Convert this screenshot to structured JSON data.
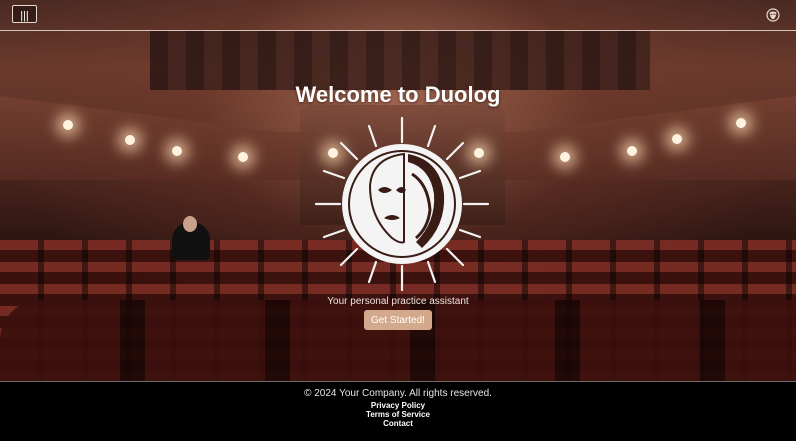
{
  "header": {
    "menu_icon": "hamburger-icon",
    "menu_glyph": "|||",
    "profile_icon": "theater-mask-icon"
  },
  "hero": {
    "title": "Welcome to Duolog",
    "logo_icon": "theater-mask-sun-logo",
    "tagline": "Your personal practice assistant",
    "cta_label": "Get Started!"
  },
  "footer": {
    "copyright": "© 2024 Your Company. All rights reserved.",
    "links": [
      "Privacy Policy",
      "Terms of Service",
      "Contact"
    ]
  },
  "colors": {
    "accent": "#d2a98c",
    "text": "#ffffff",
    "footer_bg": "#000000"
  }
}
